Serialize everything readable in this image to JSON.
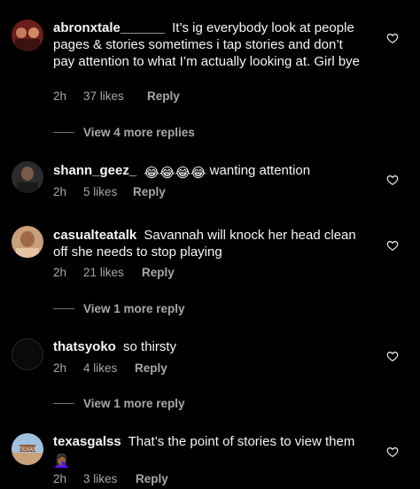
{
  "comments": [
    {
      "username": "abronxtale______",
      "text": "It’s ig everybody look at people pages & stories sometimes i tap stories and don’t pay attention to what I’m actually looking at. Girl bye",
      "time": "2h",
      "likes": "37 likes",
      "reply": "Reply",
      "avatar_icon": "avatar-photo",
      "more_replies": "View 4 more replies"
    },
    {
      "username": "shann_geez_",
      "emoji": "😂😂😂😂",
      "text": "wanting attention",
      "time": "2h",
      "likes": "5 likes",
      "reply": "Reply",
      "avatar_icon": "avatar-photo"
    },
    {
      "username": "casualteatalk",
      "text": "Savannah will knock her head clean off she needs to stop playing",
      "time": "2h",
      "likes": "21 likes",
      "reply": "Reply",
      "avatar_icon": "avatar-photo",
      "more_replies": "View 1 more reply"
    },
    {
      "username": "thatsyoko",
      "text": "so thirsty",
      "time": "2h",
      "likes": "4 likes",
      "reply": "Reply",
      "avatar_icon": "avatar-empty",
      "more_replies": "View 1 more reply"
    },
    {
      "username": "texasgalss",
      "text": "That’s the point of stories to view them",
      "emoji_after": "🤦🏾‍♀️",
      "time": "2h",
      "likes": "3 likes",
      "reply": "Reply",
      "avatar_icon": "avatar-photo-texas"
    }
  ],
  "colors": {
    "background": "#000000",
    "text": "#f5f5f5",
    "meta": "#a8a8a8"
  },
  "icons": {
    "like": "heart-outline-icon"
  }
}
